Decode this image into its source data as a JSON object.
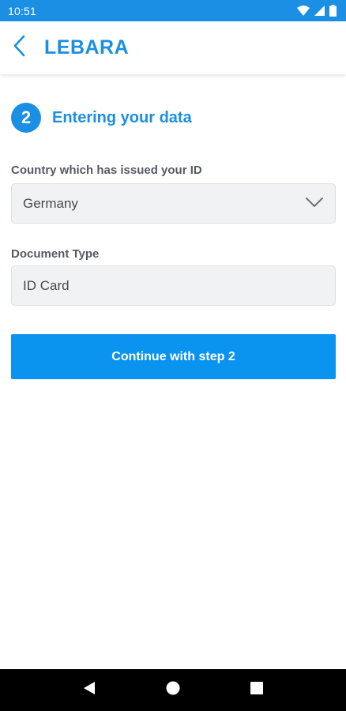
{
  "status_bar": {
    "time": "10:51",
    "icons": [
      "wifi-icon",
      "signal-icon",
      "battery-icon"
    ]
  },
  "app_bar": {
    "back_icon": "chevron-left-icon",
    "title": "LEBARA"
  },
  "step": {
    "number": "2",
    "title": "Entering your data"
  },
  "form": {
    "country_label": "Country which has issued your ID",
    "country_value": "Germany",
    "country_icon": "chevron-down-icon",
    "document_label": "Document Type",
    "document_value": "ID Card"
  },
  "actions": {
    "continue_label": "Continue with step 2"
  },
  "nav_bar": {
    "icons": [
      "back-triangle-icon",
      "home-circle-icon",
      "recents-square-icon"
    ]
  },
  "colors": {
    "brand_blue": "#1a8fe3",
    "button_blue": "#0a94f0",
    "field_bg": "#f1f2f4",
    "label_gray": "#555b63"
  }
}
